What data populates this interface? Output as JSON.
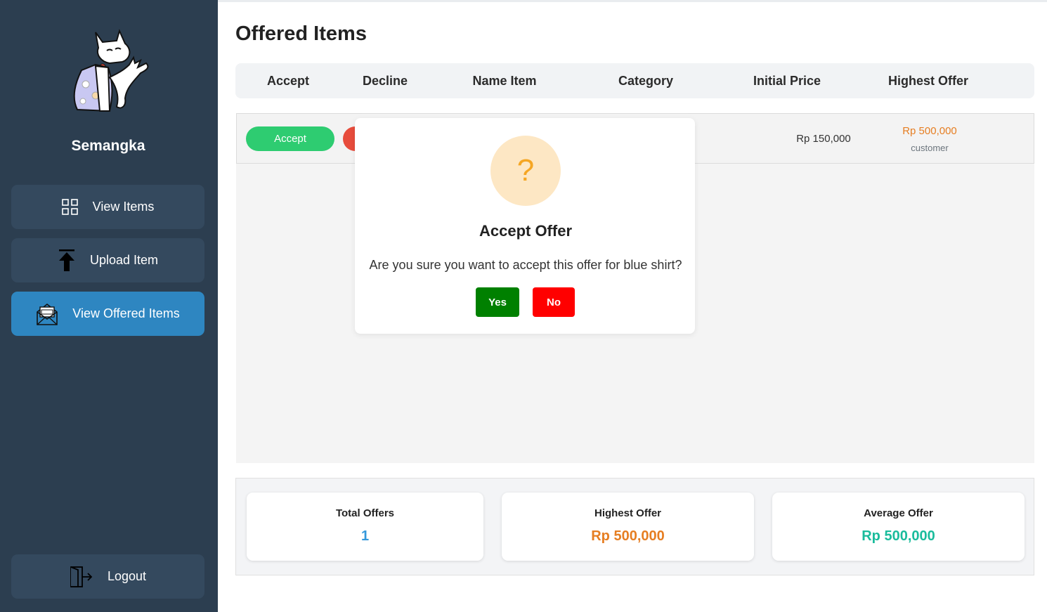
{
  "colors": {
    "sidebar_bg": "#2c3e50",
    "nav_button_bg": "#34495e",
    "nav_active_bg": "#2e86c1",
    "accept_green": "#2ecc71",
    "decline_red": "#e74c3c",
    "offer_orange": "#e67e22",
    "total_blue": "#3498db",
    "average_teal": "#1abc9c",
    "yes_green": "#008000",
    "no_red": "#ff0000"
  },
  "sidebar": {
    "username": "Semangka",
    "nav": [
      {
        "label": "View Items",
        "icon": "grid-icon"
      },
      {
        "label": "Upload Item",
        "icon": "upload-arrow-icon"
      },
      {
        "label": "View Offered Items",
        "icon": "offer-envelope-icon",
        "active": true
      }
    ],
    "logout_label": "Logout"
  },
  "main": {
    "title": "Offered Items",
    "columns": [
      "Accept",
      "Decline",
      "Name Item",
      "Category",
      "Initial Price",
      "Highest Offer"
    ],
    "rows": [
      {
        "accept_label": "Accept",
        "initial_price": "Rp 150,000",
        "highest_offer": "Rp 500,000",
        "bidder": "customer"
      }
    ]
  },
  "modal": {
    "icon": "?",
    "title": "Accept Offer",
    "message": "Are you sure you want to accept this offer for blue shirt?",
    "yes_label": "Yes",
    "no_label": "No"
  },
  "stats": {
    "total_offers": {
      "label": "Total Offers",
      "value": "1"
    },
    "highest_offer": {
      "label": "Highest Offer",
      "value": "Rp 500,000"
    },
    "average_offer": {
      "label": "Average Offer",
      "value": "Rp 500,000"
    }
  }
}
